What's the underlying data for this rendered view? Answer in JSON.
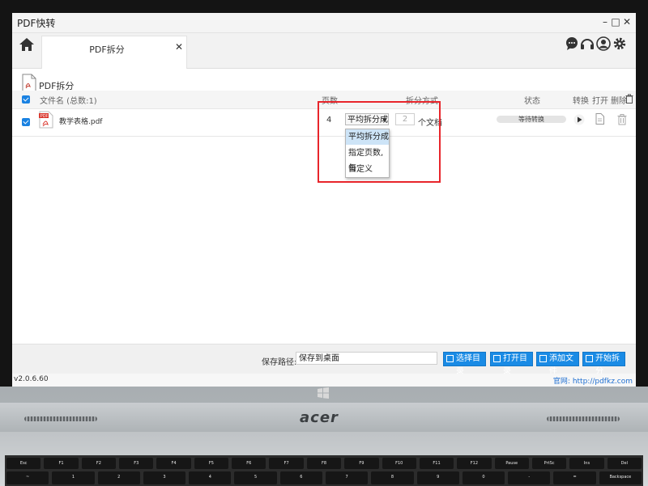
{
  "app": {
    "title": "PDF快转"
  },
  "window_controls": {
    "minimize": "–",
    "maximize": "□",
    "close": "✕"
  },
  "tab": {
    "label": "PDF拆分",
    "close": "✕"
  },
  "page": {
    "title": "PDF拆分"
  },
  "table": {
    "headers": {
      "filename": "文件名 (总数:1)",
      "pages": "页数",
      "split_mode": "拆分方式",
      "status": "状态",
      "convert": "转换",
      "open": "打开",
      "delete": "删除"
    },
    "rows": [
      {
        "filename": "教学表格.pdf",
        "pages": "4",
        "split_mode": "平均拆分成",
        "count_placeholder": "2",
        "count_unit": "个文档",
        "status": "等待转换"
      }
    ]
  },
  "dropdown": {
    "options": [
      "平均拆分成",
      "指定页数,每",
      "自定义"
    ],
    "selected": "平均拆分成"
  },
  "bottom": {
    "path_label": "保存路径:",
    "path_value": "保存到桌面",
    "buttons": [
      "选择目录",
      "打开目录",
      "添加文件",
      "开始拆分"
    ]
  },
  "statusbar": {
    "version": "v2.0.6.60",
    "website": "官网: http://pdfkz.com"
  },
  "device": {
    "brand": "acer",
    "keys_row1": [
      "Esc",
      "F1",
      "F2",
      "F3",
      "F4",
      "F5",
      "F6",
      "F7",
      "F8",
      "F9",
      "F10",
      "F11",
      "F12",
      "Pause",
      "PrtSc",
      "Ins",
      "Del"
    ],
    "keys_row2": [
      "~",
      "1",
      "2",
      "3",
      "4",
      "5",
      "6",
      "7",
      "8",
      "9",
      "0",
      "-",
      "=",
      "Backspace"
    ]
  },
  "colors": {
    "accent": "#1a8be5",
    "highlight": "#e8252b",
    "selected_option": "#cde4f7",
    "pdf_red": "#d9352b"
  }
}
